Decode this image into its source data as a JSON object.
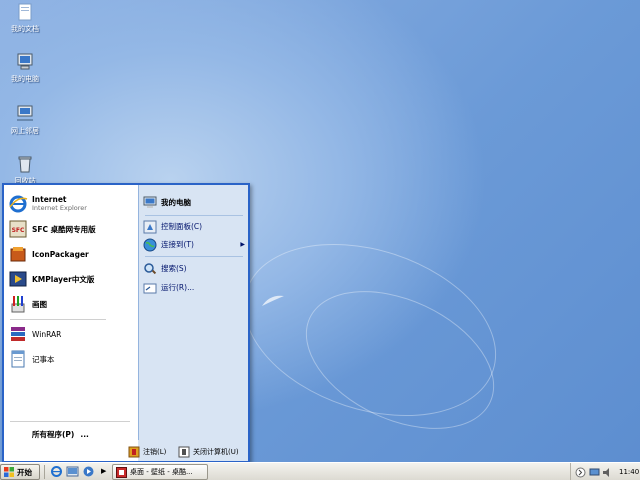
{
  "desktop": {
    "icons": [
      {
        "label": "我的文档",
        "icon": "my-documents-icon"
      },
      {
        "label": "我的电脑",
        "icon": "my-computer-icon"
      },
      {
        "label": "网上邻居",
        "icon": "network-places-icon"
      },
      {
        "label": "回收站",
        "icon": "recycle-bin-icon"
      }
    ]
  },
  "start_menu": {
    "pinned": [
      {
        "title": "Internet",
        "subtitle": "Internet Explorer",
        "icon": "internet-explorer-icon"
      },
      {
        "title": "SFC 桌酷网专用版",
        "icon": "sfc-icon"
      }
    ],
    "recent": [
      {
        "title": "IconPackager",
        "icon": "iconpackager-icon"
      },
      {
        "title": "KMPlayer中文版",
        "icon": "kmplayer-icon"
      },
      {
        "title": "画图",
        "icon": "paint-icon"
      },
      {
        "title": "WinRAR",
        "icon": "winrar-icon"
      },
      {
        "title": "记事本",
        "icon": "notepad-icon"
      }
    ],
    "all_programs": "所有程序(P)",
    "all_programs_dots": "...",
    "right": {
      "my_computer": "我的电脑",
      "control_panel": "控制面板(C)",
      "connect_to": "连接到(T)",
      "search": "搜索(S)",
      "run": "运行(R)..."
    },
    "logoff": "注销(L)",
    "shutdown": "关闭计算机(U)"
  },
  "taskbar": {
    "start_label": "开始",
    "task_label": "桌面 - 壁纸 - 桌酷...",
    "clock": "11:40",
    "colors": {
      "menu_border": "#2a63c7",
      "right_pane": "#d8e4f3"
    }
  }
}
